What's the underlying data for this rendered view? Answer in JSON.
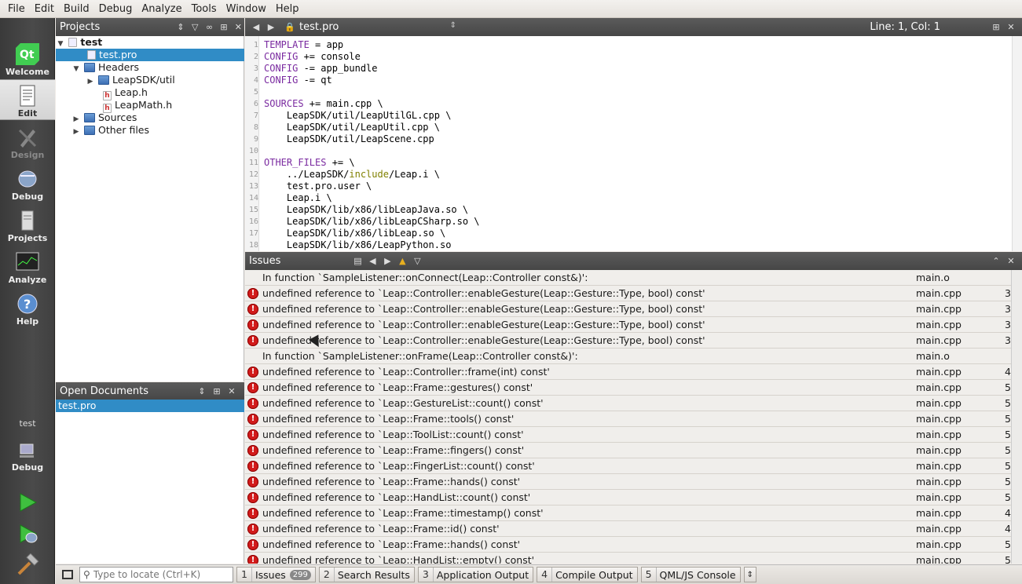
{
  "menu": [
    "File",
    "Edit",
    "Build",
    "Debug",
    "Analyze",
    "Tools",
    "Window",
    "Help"
  ],
  "modes": [
    {
      "label": "Welcome",
      "icon": "qt-logo-icon"
    },
    {
      "label": "Edit",
      "icon": "document-icon"
    },
    {
      "label": "Design",
      "icon": "pencil-icon"
    },
    {
      "label": "Debug",
      "icon": "bug-icon"
    },
    {
      "label": "Projects",
      "icon": "wrench-file-icon"
    },
    {
      "label": "Analyze",
      "icon": "chart-icon"
    },
    {
      "label": "Help",
      "icon": "question-icon"
    }
  ],
  "kit": {
    "project": "test",
    "mode": "Debug"
  },
  "projects_panel": {
    "title": "Projects",
    "tree": [
      {
        "label": "test",
        "bold": true
      },
      {
        "label": "test.pro"
      },
      {
        "label": "Headers"
      },
      {
        "label": "LeapSDK/util"
      },
      {
        "label": "Leap.h"
      },
      {
        "label": "LeapMath.h"
      },
      {
        "label": "Sources"
      },
      {
        "label": "Other files"
      }
    ]
  },
  "open_documents": {
    "title": "Open Documents",
    "items": [
      "test.pro"
    ]
  },
  "editor": {
    "file": "test.pro",
    "position": "Line: 1, Col: 1",
    "lines": [
      {
        "n": "1"
      },
      {
        "n": "2"
      },
      {
        "n": "3"
      },
      {
        "n": "4"
      },
      {
        "n": "5"
      },
      {
        "n": "6"
      },
      {
        "n": "7"
      },
      {
        "n": "8"
      },
      {
        "n": "9"
      },
      {
        "n": "10"
      },
      {
        "n": "11"
      },
      {
        "n": "12"
      },
      {
        "n": "13"
      },
      {
        "n": "14"
      },
      {
        "n": "15"
      },
      {
        "n": "16"
      },
      {
        "n": "17"
      },
      {
        "n": "18"
      }
    ],
    "code": [
      [
        "TEMPLATE",
        " = app"
      ],
      [
        "CONFIG",
        " += console"
      ],
      [
        "CONFIG",
        " -= app_bundle"
      ],
      [
        "CONFIG",
        " -= qt"
      ],
      [
        "",
        ""
      ],
      [
        "SOURCES",
        " += main.cpp \\"
      ],
      [
        "",
        "    LeapSDK/util/LeapUtilGL.cpp \\"
      ],
      [
        "",
        "    LeapSDK/util/LeapUtil.cpp \\"
      ],
      [
        "",
        "    LeapSDK/util/LeapScene.cpp"
      ],
      [
        "",
        ""
      ],
      [
        "OTHER_FILES",
        " += \\"
      ],
      [
        "",
        "    ../LeapSDK/",
        "include",
        "/Leap.i \\"
      ],
      [
        "",
        "    test.pro.user \\"
      ],
      [
        "",
        "    Leap.i \\"
      ],
      [
        "",
        "    LeapSDK/lib/x86/libLeapJava.so \\"
      ],
      [
        "",
        "    LeapSDK/lib/x86/libLeapCSharp.so \\"
      ],
      [
        "",
        "    LeapSDK/lib/x86/libLeap.so \\"
      ],
      [
        "",
        "    LeapSDK/lib/x86/LeapPython.so"
      ]
    ]
  },
  "issues": {
    "title": "Issues",
    "rows": [
      {
        "error": false,
        "msg": "In function `SampleListener::onConnect(Leap::Controller const&)':",
        "file": "main.o",
        "line": ""
      },
      {
        "error": true,
        "msg": "undefined reference to `Leap::Controller::enableGesture(Leap::Gesture::Type, bool) const'",
        "file": "main.cpp",
        "line": "3"
      },
      {
        "error": true,
        "msg": "undefined reference to `Leap::Controller::enableGesture(Leap::Gesture::Type, bool) const'",
        "file": "main.cpp",
        "line": "3"
      },
      {
        "error": true,
        "msg": "undefined reference to `Leap::Controller::enableGesture(Leap::Gesture::Type, bool) const'",
        "file": "main.cpp",
        "line": "3"
      },
      {
        "error": true,
        "msg": "undefined reference to `Leap::Controller::enableGesture(Leap::Gesture::Type, bool) const'",
        "file": "main.cpp",
        "line": "3"
      },
      {
        "error": false,
        "msg": "In function `SampleListener::onFrame(Leap::Controller const&)':",
        "file": "main.o",
        "line": ""
      },
      {
        "error": true,
        "msg": "undefined reference to `Leap::Controller::frame(int) const'",
        "file": "main.cpp",
        "line": "4"
      },
      {
        "error": true,
        "msg": "undefined reference to `Leap::Frame::gestures() const'",
        "file": "main.cpp",
        "line": "5"
      },
      {
        "error": true,
        "msg": "undefined reference to `Leap::GestureList::count() const'",
        "file": "main.cpp",
        "line": "5"
      },
      {
        "error": true,
        "msg": "undefined reference to `Leap::Frame::tools() const'",
        "file": "main.cpp",
        "line": "5"
      },
      {
        "error": true,
        "msg": "undefined reference to `Leap::ToolList::count() const'",
        "file": "main.cpp",
        "line": "5"
      },
      {
        "error": true,
        "msg": "undefined reference to `Leap::Frame::fingers() const'",
        "file": "main.cpp",
        "line": "5"
      },
      {
        "error": true,
        "msg": "undefined reference to `Leap::FingerList::count() const'",
        "file": "main.cpp",
        "line": "5"
      },
      {
        "error": true,
        "msg": "undefined reference to `Leap::Frame::hands() const'",
        "file": "main.cpp",
        "line": "5"
      },
      {
        "error": true,
        "msg": "undefined reference to `Leap::HandList::count() const'",
        "file": "main.cpp",
        "line": "5"
      },
      {
        "error": true,
        "msg": "undefined reference to `Leap::Frame::timestamp() const'",
        "file": "main.cpp",
        "line": "4"
      },
      {
        "error": true,
        "msg": "undefined reference to `Leap::Frame::id() const'",
        "file": "main.cpp",
        "line": "4"
      },
      {
        "error": true,
        "msg": "undefined reference to `Leap::Frame::hands() const'",
        "file": "main.cpp",
        "line": "5"
      },
      {
        "error": true,
        "msg": "undefined reference to `Leap::HandList::empty() const'",
        "file": "main.cpp",
        "line": "5"
      }
    ]
  },
  "statusbar": {
    "locator_placeholder": "Type to locate (Ctrl+K)",
    "tabs": [
      {
        "num": "1",
        "label": "Issues",
        "badge": "299"
      },
      {
        "num": "2",
        "label": "Search Results"
      },
      {
        "num": "3",
        "label": "Application Output"
      },
      {
        "num": "4",
        "label": "Compile Output"
      },
      {
        "num": "5",
        "label": "QML/JS Console"
      }
    ]
  }
}
